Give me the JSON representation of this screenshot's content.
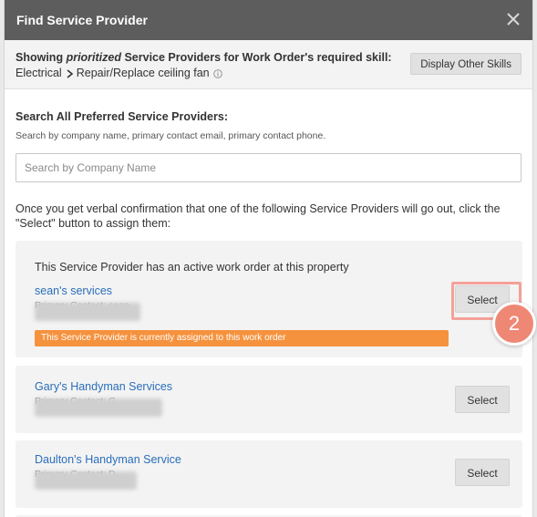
{
  "modal": {
    "title": "Find Service Provider",
    "close_icon": "close-icon"
  },
  "skill": {
    "prefix": "Showing ",
    "emphasis": "prioritized",
    "middle": " Service Providers for Work Order's required skill:",
    "category": "Electrical",
    "separator_icon": "chevron-right-icon",
    "task": "Repair/Replace ceiling fan",
    "info_icon": "info-icon",
    "other_skills_button": "Display Other Skills"
  },
  "search": {
    "title": "Search All Preferred Service Providers:",
    "help": "Search by company name, primary contact email, primary contact phone.",
    "placeholder": "Search by Company Name",
    "value": ""
  },
  "instructions": "Once you get verbal confirmation that one of the following Service Providers will go out, click the \"Select\" button to assign them:",
  "providers": [
    {
      "note": "This Service Provider has an active work order at this property",
      "name": "sean's services",
      "contact_label": "Primary Contact: sean",
      "select_label": "Select",
      "assigned_banner": "This Service Provider is currently assigned to this work order"
    },
    {
      "name": "Gary's Handyman Services",
      "contact_label": "Primary Contact: G",
      "select_label": "Select"
    },
    {
      "name": "Daulton's Handyman Service",
      "contact_label": "Primary Contact: D",
      "select_label": "Select"
    }
  ],
  "annotation": {
    "step_number": "2",
    "highlight_color": "#f4a199",
    "badge_color": "#ef8775"
  },
  "colors": {
    "header_bg": "#5d5d5d",
    "link": "#2a6ebb",
    "banner": "#f5923e",
    "card_bg": "#f3f3f3"
  }
}
